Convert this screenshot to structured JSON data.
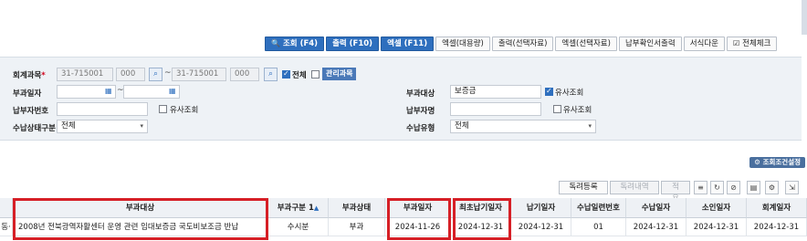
{
  "toolbar": {
    "search": "조회 (F4)",
    "print": "출력 (F10)",
    "excel": "엑셀 (F11)",
    "excel_large": "엑셀(대용량)",
    "print_selected": "출력(선택자료)",
    "excel_selected": "엑셀(선택자료)",
    "payment_confirm_print": "납부확인서출력",
    "form_download": "서식다운",
    "check_all": "전체체크"
  },
  "search": {
    "account_label": "회계과목",
    "account_from_code": "31-715001",
    "account_from_sub": "000",
    "account_to_code": "31-715001",
    "account_to_sub": "000",
    "all_label": "전체",
    "manage_account_button": "관리과목",
    "levy_date_label": "부과일자",
    "payer_no_label": "납부자번호",
    "similar_label_1": "유사조회",
    "collection_status_label": "수납상태구분",
    "collection_status_value": "전체",
    "levy_target_label": "부과대상",
    "levy_target_value": "보증금",
    "similar_label_2": "유사조회",
    "payer_name_label": "납부자명",
    "similar_label_3": "유사조회",
    "collection_type_label": "수납유형",
    "collection_type_value": "전체",
    "condition_settings": "조회조건설정"
  },
  "list_toolbar": {
    "individual_register": "독려등록",
    "individual_history": "독려내역",
    "apply": "적용"
  },
  "grid": {
    "columns": [
      "부과대상",
      "부과구분",
      "부과상태",
      "부과일자",
      "최초납기일자",
      "납기일자",
      "수납일련번호",
      "수납일자",
      "소인일자",
      "회계일자"
    ],
    "sort_indicator": "1",
    "first_col_fragment": "동·",
    "rows": [
      {
        "target": "2008년 전북광역자활센터 운영 관련 임대보증금 국도비보조금 반납",
        "type": "수시분",
        "status": "부과",
        "levy_date": "2024-11-26",
        "first_due_date": "2024-12-31",
        "due_date": "2024-12-31",
        "seq": "01",
        "collection_date": "2024-12-31",
        "postmark_date": "2024-12-31",
        "accounting_date": "2024-12-31"
      }
    ]
  },
  "colors": {
    "accent": "#2e6fbe",
    "highlight": "#d61f26",
    "panel": "#eef2f6"
  }
}
